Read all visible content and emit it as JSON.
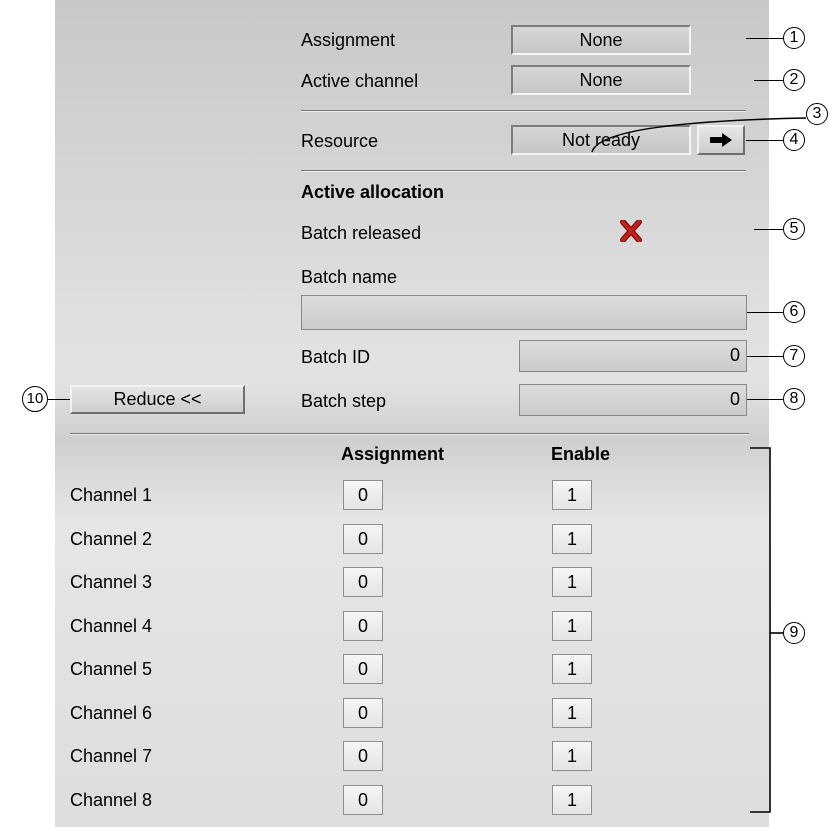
{
  "top": {
    "assignment_label": "Assignment",
    "assignment_value": "None",
    "active_channel_label": "Active channel",
    "active_channel_value": "None",
    "resource_label": "Resource",
    "resource_value": "Not ready",
    "resource_nav_icon": "arrow-right-icon"
  },
  "allocation": {
    "heading": "Active allocation",
    "batch_released_label": "Batch released",
    "batch_released_icon": "red-x-icon",
    "batch_name_label": "Batch name",
    "batch_name_value": "",
    "batch_id_label": "Batch ID",
    "batch_id_value": "0",
    "batch_step_label": "Batch step",
    "batch_step_value": "0"
  },
  "reduce_button": "Reduce <<",
  "channels": {
    "header_assignment": "Assignment",
    "header_enable": "Enable",
    "rows": [
      {
        "name": "Channel 1",
        "assignment": "0",
        "enable": "1"
      },
      {
        "name": "Channel 2",
        "assignment": "0",
        "enable": "1"
      },
      {
        "name": "Channel 3",
        "assignment": "0",
        "enable": "1"
      },
      {
        "name": "Channel 4",
        "assignment": "0",
        "enable": "1"
      },
      {
        "name": "Channel 5",
        "assignment": "0",
        "enable": "1"
      },
      {
        "name": "Channel 6",
        "assignment": "0",
        "enable": "1"
      },
      {
        "name": "Channel 7",
        "assignment": "0",
        "enable": "1"
      },
      {
        "name": "Channel 8",
        "assignment": "0",
        "enable": "1"
      }
    ]
  },
  "callouts": [
    "1",
    "2",
    "3",
    "4",
    "5",
    "6",
    "7",
    "8",
    "9",
    "10"
  ],
  "colors": {
    "error_x": "#b41a1a"
  }
}
